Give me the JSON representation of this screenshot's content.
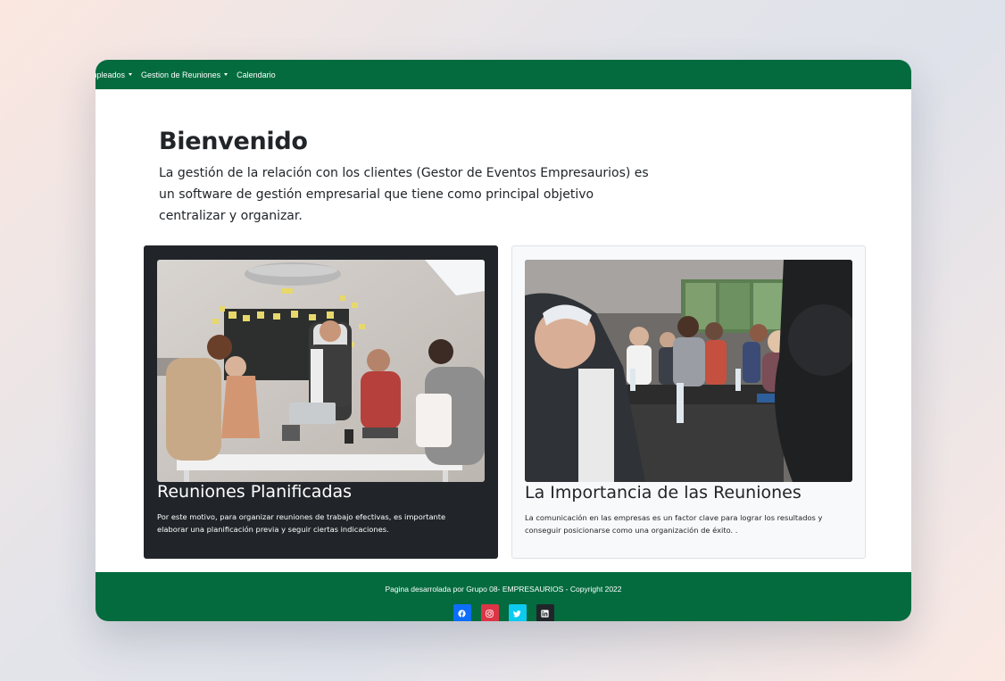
{
  "navbar": {
    "items": [
      {
        "label": "mpleados",
        "dropdown": true
      },
      {
        "label": "Gestion de Reuniones",
        "dropdown": true
      },
      {
        "label": "Calendario",
        "dropdown": false
      }
    ],
    "color": "#036b3e"
  },
  "hero": {
    "title": "Bienvenido",
    "lines": [
      "La gestión de la relación con los clientes (Gestor de Eventos Empresaurios) es",
      "un software de gestión empresarial que tiene como principal objetivo",
      "centralizar y organizar."
    ]
  },
  "cards": [
    {
      "title": "Reuniones Planificadas",
      "lines": [
        "Por este motivo, para organizar reuniones de trabajo efectivas, es importante",
        "elaborar una planificación previa y seguir ciertas indicaciones."
      ],
      "theme": "dark"
    },
    {
      "title": "La Importancia de las Reuniones",
      "lines": [
        "La comunicación en las empresas es un factor clave para lograr los resultados y",
        "conseguir posicionarse como una organización de éxito. ."
      ],
      "theme": "light"
    }
  ],
  "footer": {
    "copyright": "Pagina desarrolada por Grupo 08- EMPRESAURIOS - Copyright 2022",
    "socials": [
      {
        "icon": "facebook-icon",
        "color": "#0d6efd"
      },
      {
        "icon": "instagram-icon",
        "color": "#dc3545"
      },
      {
        "icon": "twitter-icon",
        "color": "#0dcaf0"
      },
      {
        "icon": "linkedin-icon",
        "color": "#212529"
      }
    ]
  }
}
